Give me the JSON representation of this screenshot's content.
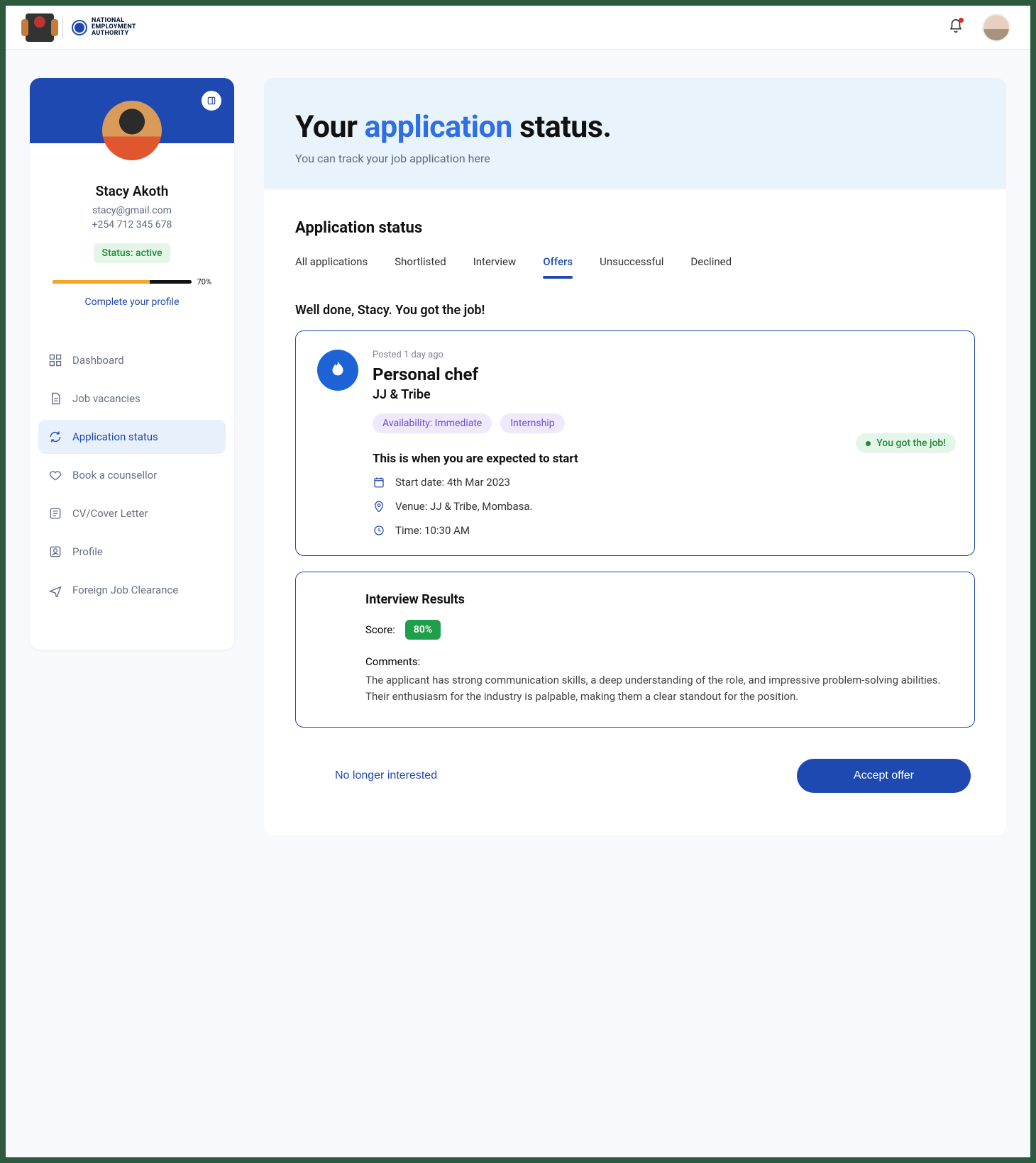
{
  "header": {
    "org_line1": "NATIONAL",
    "org_line2": "EMPLOYMENT",
    "org_line3": "AUTHORITY"
  },
  "profile": {
    "name": "Stacy Akoth",
    "email": "stacy@gmail.com",
    "phone": "+254 712 345 678",
    "status_label": "Status: active",
    "progress_pct": "70%",
    "complete_link": "Complete your profile"
  },
  "nav": {
    "dashboard": "Dashboard",
    "jobs": "Job vacancies",
    "app_status": "Application status",
    "counsellor": "Book a counsellor",
    "cv": "CV/Cover Letter",
    "profile": "Profile",
    "foreign": "Foreign Job Clearance"
  },
  "hero": {
    "pre": "Your ",
    "highlight": "application",
    "post": " status.",
    "sub": "You can track your job application here"
  },
  "section_title": "Application status",
  "tabs": {
    "all": "All applications",
    "shortlisted": "Shortlisted",
    "interview": "Interview",
    "offers": "Offers",
    "unsuccessful": "Unsuccessful",
    "declined": "Declined"
  },
  "congrats": "Well done, Stacy. You got the job!",
  "offer": {
    "posted": "Posted 1 day ago",
    "title": "Personal chef",
    "company": "JJ & Tribe",
    "chip_availability": "Availability: Immediate",
    "chip_type": "Internship",
    "got_job": "You got the job!",
    "expect_heading": "This is when you are expected to start",
    "start": "Start date: 4th Mar 2023",
    "venue": "Venue: JJ & Tribe, Mombasa.",
    "time": "Time: 10:30 AM"
  },
  "results": {
    "heading": "Interview Results",
    "score_label": "Score:",
    "score_value": "80%",
    "comments_label": "Comments:",
    "comments_text": "The applicant has strong communication skills, a deep understanding of the role, and impressive problem-solving abilities. Their enthusiasm for the industry is palpable, making them a clear standout for the position."
  },
  "actions": {
    "reject": "No longer interested",
    "accept": "Accept offer"
  }
}
